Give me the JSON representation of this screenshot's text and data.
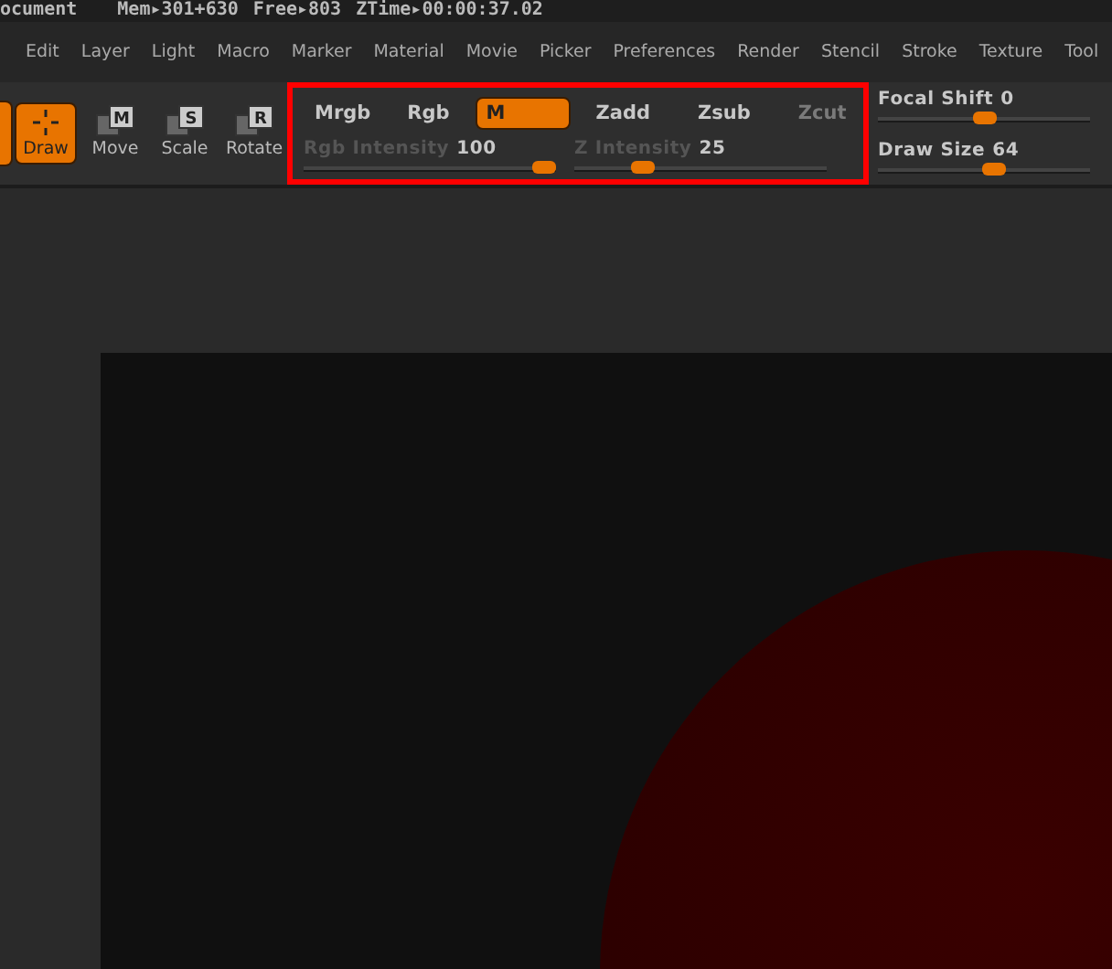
{
  "title_bar": {
    "document": "ocument",
    "stats": [
      {
        "label": "Mem▸",
        "value": "301+630"
      },
      {
        "label": "Free▸",
        "value": "803"
      },
      {
        "label": "ZTime▸",
        "value": "00:00:37.02"
      }
    ]
  },
  "menu_bar": [
    "Edit",
    "Layer",
    "Light",
    "Macro",
    "Marker",
    "Material",
    "Movie",
    "Picker",
    "Preferences",
    "Render",
    "Stencil",
    "Stroke",
    "Texture",
    "Tool"
  ],
  "tools": [
    {
      "label": "Draw",
      "kind": "draw",
      "selected": true
    },
    {
      "label": "Move",
      "key": "M",
      "kind": "transform",
      "selected": false
    },
    {
      "label": "Scale",
      "key": "S",
      "kind": "transform",
      "selected": false
    },
    {
      "label": "Rotate",
      "key": "R",
      "kind": "transform",
      "selected": false
    }
  ],
  "modes": [
    {
      "label": "Mrgb",
      "selected": false,
      "disabled": false
    },
    {
      "label": "Rgb",
      "selected": false,
      "disabled": false
    },
    {
      "label": "M",
      "selected": true,
      "disabled": false
    }
  ],
  "z_modes": [
    {
      "label": "Zadd",
      "selected": false,
      "disabled": false
    },
    {
      "label": "Zsub",
      "selected": false,
      "disabled": false
    },
    {
      "label": "Zcut",
      "selected": false,
      "disabled": true
    }
  ],
  "intensity_sliders": [
    {
      "name": "Rgb Intensity",
      "reading": "100",
      "level": 1,
      "disabled": true
    },
    {
      "name": "Z Intensity",
      "reading": "25",
      "level": 0.25,
      "disabled": true
    }
  ],
  "brush_sliders": [
    {
      "name": "Focal Shift",
      "reading": "0",
      "level": 0.5,
      "disabled": false
    },
    {
      "name": "Draw Size",
      "reading": "64",
      "level": 0.55,
      "disabled": false
    }
  ]
}
